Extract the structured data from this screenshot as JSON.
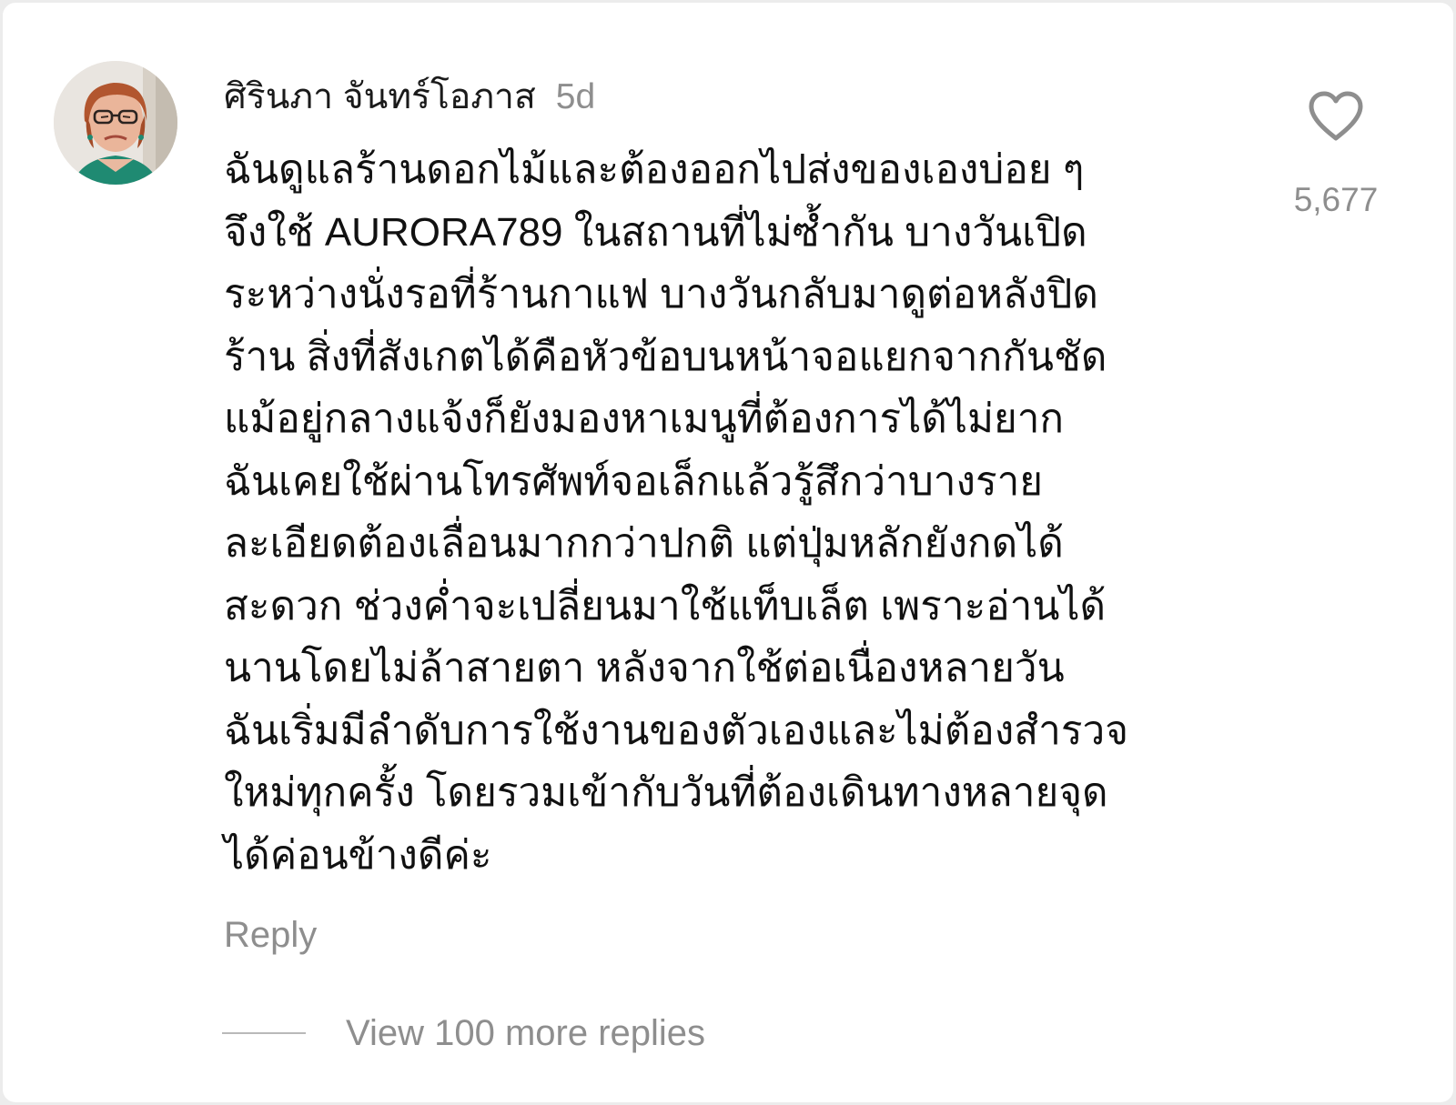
{
  "comment": {
    "author": "ศิรินภา จันทร์โอภาส",
    "time_ago": "5d",
    "body_lines": [
      "ฉันดูแลร้านดอกไม้และต้องออกไปส่งของเองบ่อย ๆ",
      "จึงใช้ AURORA789 ในสถานที่ไม่ซ้ำกัน บางวันเปิด",
      "ระหว่างนั่งรอที่ร้านกาแฟ บางวันกลับมาดูต่อหลังปิด",
      "ร้าน สิ่งที่สังเกตได้คือหัวข้อบนหน้าจอแยกจากกันชัด",
      "แม้อยู่กลางแจ้งก็ยังมองหาเมนูที่ต้องการได้ไม่ยาก",
      "ฉันเคยใช้ผ่านโทรศัพท์จอเล็กแล้วรู้สึกว่าบางราย",
      "ละเอียดต้องเลื่อนมากกว่าปกติ แต่ปุ่มหลักยังกดได้",
      "สะดวก ช่วงค่ำจะเปลี่ยนมาใช้แท็บเล็ต เพราะอ่านได้",
      "นานโดยไม่ล้าสายตา หลังจากใช้ต่อเนื่องหลายวัน",
      "ฉันเริ่มมีลำดับการใช้งานของตัวเองและไม่ต้องสำรวจ",
      "ใหม่ทุกครั้ง โดยรวมเข้ากับวันที่ต้องเดินทางหลายจุด",
      "ได้ค่อนข้างดีค่ะ"
    ],
    "like_count": "5,677",
    "like_icon": "heart-outline-icon",
    "reply_label": "Reply",
    "view_replies_label": "View 100 more replies"
  },
  "colors": {
    "text": "#111111",
    "muted": "#8e8e8e",
    "background": "#ffffff"
  }
}
